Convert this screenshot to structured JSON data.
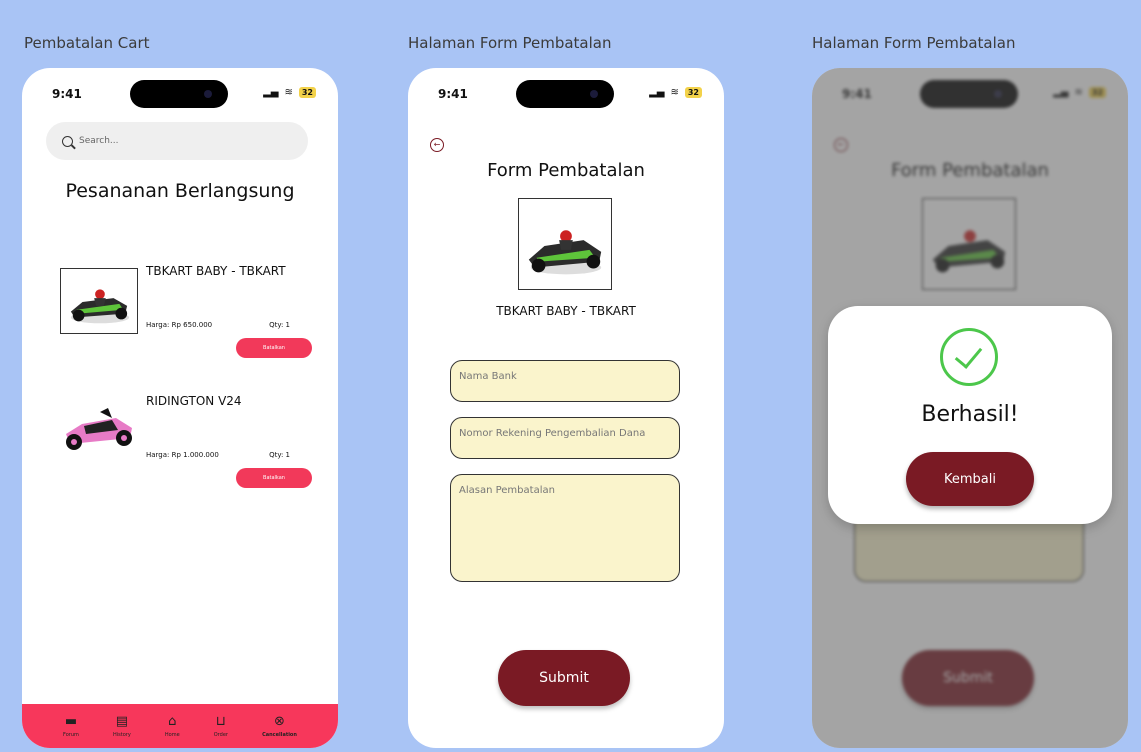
{
  "frames": [
    {
      "title": "Pembatalan Cart"
    },
    {
      "title": "Halaman Form Pembatalan"
    },
    {
      "title": "Halaman Form Pembatalan"
    }
  ],
  "status": {
    "time": "9:41",
    "battery": "32"
  },
  "cart": {
    "search_placeholder": "Search...",
    "title": "Pesananan Berlangsung",
    "items": [
      {
        "name": "TBKART BABY - TBKART",
        "price": "Harga: Rp 650.000",
        "qty": "Qty: 1",
        "cancel_label": "Batalkan"
      },
      {
        "name": "RIDINGTON V24",
        "price": "Harga: Rp 1.000.000",
        "qty": "Qty: 1",
        "cancel_label": "Batalkan"
      }
    ],
    "nav": [
      {
        "label": "Forum",
        "icon": "chat-icon"
      },
      {
        "label": "History",
        "icon": "calendar-icon"
      },
      {
        "label": "Home",
        "icon": "home-icon"
      },
      {
        "label": "Order",
        "icon": "cart-icon"
      },
      {
        "label": "Cancellation",
        "icon": "cancel-circle-icon"
      }
    ]
  },
  "form": {
    "title": "Form Pembatalan",
    "product_name": "TBKART BABY - TBKART",
    "bank_placeholder": "Nama Bank",
    "account_placeholder": "Nomor Rekening Pengembalian Dana",
    "reason_placeholder": "Alasan Pembatalan",
    "submit_label": "Submit"
  },
  "popup": {
    "message": "Berhasil!",
    "button_label": "Kembali"
  },
  "colors": {
    "accent": "#f7375b",
    "maroon": "#7a1a24",
    "field_bg": "#faf4cc",
    "success": "#4cc74b",
    "background": "#a9c4f5"
  }
}
